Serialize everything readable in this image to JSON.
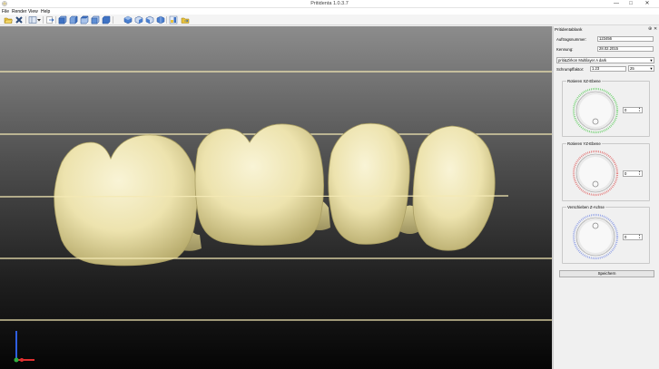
{
  "window": {
    "title": "Pritidenta 1.0.3.7",
    "minimize_glyph": "—",
    "maximize_glyph": "□",
    "close_glyph": "✕"
  },
  "menu": {
    "items": [
      "File",
      "Render",
      "View",
      "Help"
    ]
  },
  "toolbar": {
    "icons": [
      "open-folder-icon",
      "delete-icon",
      "layout-icon",
      "dropdown-icon",
      "import-icon",
      "view-front-icon",
      "view-back-icon",
      "view-left-icon",
      "view-right-icon",
      "view-top-icon",
      "shade-1-icon",
      "shade-2-icon",
      "shade-3-icon",
      "shade-4-icon",
      "export-icon",
      "folder-out-icon"
    ]
  },
  "viewport": {
    "tooth_color": "#efe6b4",
    "guide_line_color": "#f1e3a6",
    "axis_x_color": "#e03030",
    "axis_y_color": "#2f5fe0",
    "axis_z_color": "#30b040"
  },
  "panel": {
    "title": "Pritidentablank",
    "pin_glyph": "⊕",
    "close_glyph": "✕",
    "auftragsnummer_label": "Auftragsnummer:",
    "auftragsnummer_value": "123456",
    "kennung_label": "Kennung:",
    "kennung_value": "28.02.2015",
    "material_value": "priti&Zirkon Multilayer A dark",
    "schrumpf_label": "Schrumpffaktor:",
    "schrumpf_value": "1.23",
    "blank_size_value": "25",
    "groups": [
      {
        "title": "Rotieren XZ-Ebene",
        "value": "0",
        "color": "#6cd06c"
      },
      {
        "title": "Rotieren YZ-Ebene",
        "value": "0",
        "color": "#e27272"
      },
      {
        "title": "Verschieben Z-Achse",
        "value": "0",
        "color": "#8a9be6"
      }
    ],
    "save_label": "Speichern"
  }
}
